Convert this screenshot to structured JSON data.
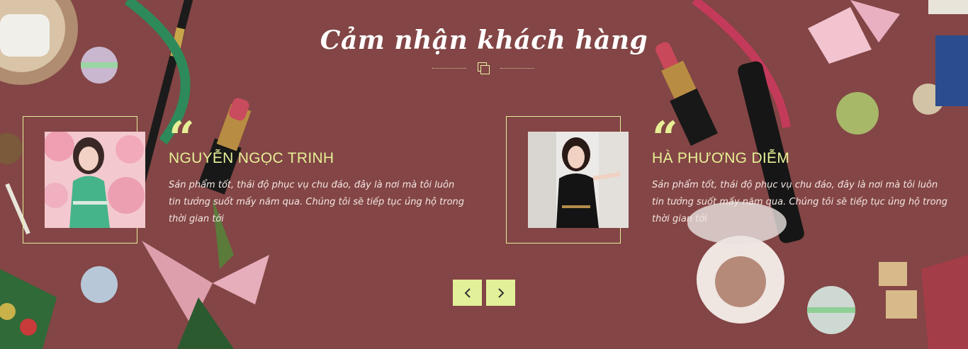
{
  "section": {
    "title": "Cảm nhận khách hàng"
  },
  "testimonials": [
    {
      "name": "NGUYỄN NGỌC TRINH",
      "quote_mark": "“",
      "text": "Sản phẩm tốt, thái độ phục vụ chu đáo, đây là nơi mà tôi luôn tin tưởng suốt mấy năm qua. Chúng tôi sẽ tiếp tục ủng hộ trong thời gian tới"
    },
    {
      "name": "HÀ PHƯƠNG DIỄM",
      "quote_mark": "“",
      "text": "Sản phẩm tốt, thái độ phục vụ chu đáo, đây là nơi mà tôi luôn tin tưởng suốt mấy năm qua. Chúng tôi sẽ tiếp tục ủng hộ trong thời gian tới"
    }
  ],
  "navigation": {
    "prev_icon": "chevron-left-icon",
    "next_icon": "chevron-right-icon"
  },
  "colors": {
    "background": "#834545",
    "accent": "#e7ef96",
    "title": "#ffffff"
  }
}
